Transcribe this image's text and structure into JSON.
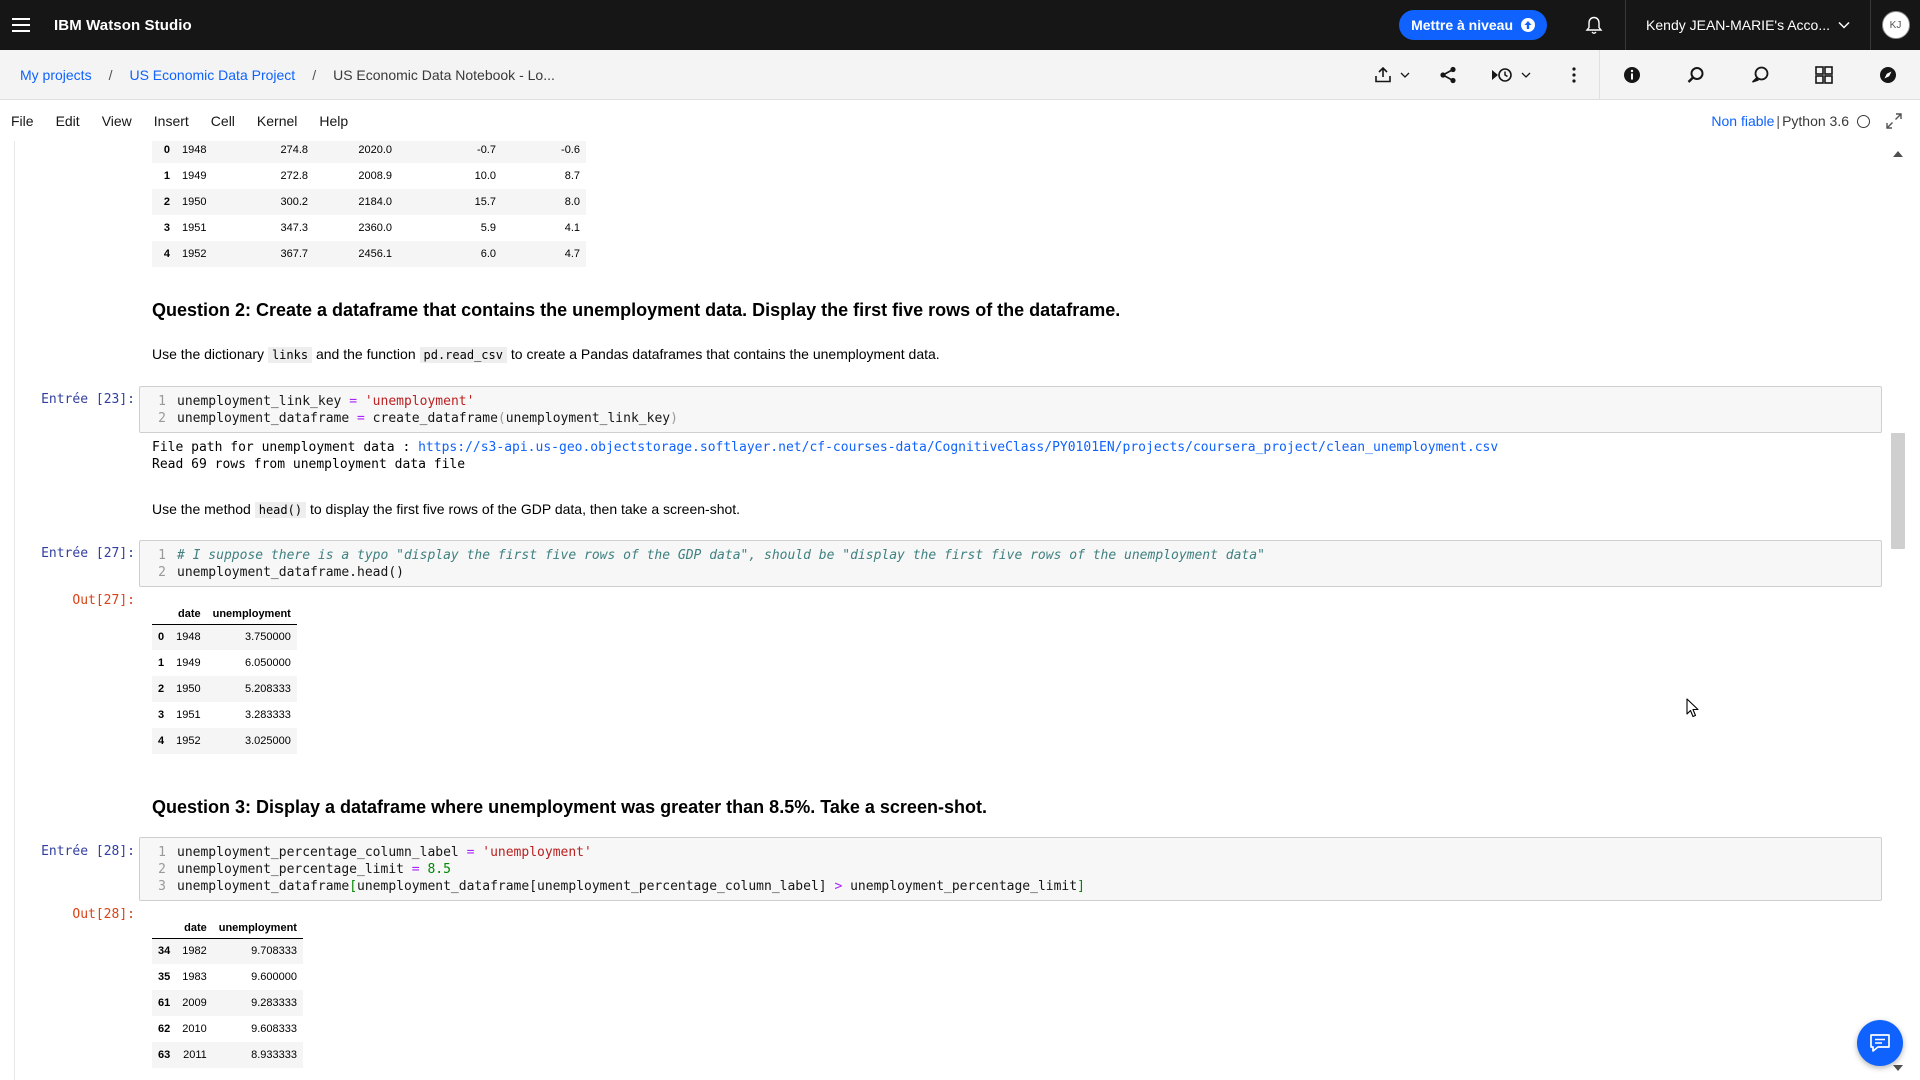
{
  "topbar": {
    "brand": "IBM Watson Studio",
    "upgrade_label": "Mettre à niveau",
    "account_label": "Kendy JEAN-MARIE's Acco...",
    "avatar_initials": "KJ"
  },
  "breadcrumb": {
    "items": [
      "My projects",
      "US Economic Data Project"
    ],
    "separator": "/",
    "current": "US Economic Data Notebook - Lo..."
  },
  "toolbar_icons": [
    "export-icon",
    "share-icon",
    "version-history-icon",
    "overflow-menu-icon",
    "info-icon",
    "find-icon",
    "comments-icon",
    "data-assets-icon",
    "explore-icon"
  ],
  "menu": {
    "items": [
      "File",
      "Edit",
      "View",
      "Insert",
      "Cell",
      "Kernel",
      "Help"
    ],
    "trust_label": "Non fiable",
    "separator": "|",
    "kernel_label": "Python 3.6"
  },
  "gdp_table_partial": {
    "rows": [
      {
        "index": "0",
        "cells": [
          "1948",
          "274.8",
          "2020.0",
          "-0.7",
          "-0.6"
        ]
      },
      {
        "index": "1",
        "cells": [
          "1949",
          "272.8",
          "2008.9",
          "10.0",
          "8.7"
        ]
      },
      {
        "index": "2",
        "cells": [
          "1950",
          "300.2",
          "2184.0",
          "15.7",
          "8.0"
        ]
      },
      {
        "index": "3",
        "cells": [
          "1951",
          "347.3",
          "2360.0",
          "5.9",
          "4.1"
        ]
      },
      {
        "index": "4",
        "cells": [
          "1952",
          "367.7",
          "2456.1",
          "6.0",
          "4.7"
        ]
      }
    ]
  },
  "question2": {
    "heading": "Question 2: Create a dataframe that contains the unemployment data. Display the first five rows of the dataframe.",
    "text_pre": "Use the dictionary ",
    "code1": "links",
    "text_mid": " and the function ",
    "code2": "pd.read_csv",
    "text_post": " to create a Pandas dataframes that contains the unemployment data."
  },
  "cell23": {
    "prompt": "Entrée [23]:",
    "line_numbers": [
      "1",
      "2"
    ],
    "line1_var": "unemployment_link_key",
    "line1_op": " = ",
    "line1_str": "'unemployment'",
    "line2_var": "unemployment_dataframe",
    "line2_op": " = ",
    "line2_fn": "create_dataframe",
    "line2_open": "(",
    "line2_arg": "unemployment_link_key",
    "line2_close": ")",
    "output_line1_pre": "File path for unemployment data : ",
    "output_line1_link": "https://s3-api.us-geo.objectstorage.softlayer.net/cf-courses-data/CognitiveClass/PY0101EN/projects/coursera_project/clean_unemployment.csv",
    "output_line2": "Read 69 rows from unemployment data file"
  },
  "md_head": {
    "text_pre": "Use the method ",
    "code": "head()",
    "text_post": " to display the first five rows of the GDP data, then take a screen-shot."
  },
  "cell27": {
    "prompt": "Entrée [27]:",
    "out_prompt": "Out[27]:",
    "line_numbers": [
      "1",
      "2"
    ],
    "line1_comment": "# I suppose there is a typo \"display the first five rows of the GDP data\", should be \"display the first five rows of the unemployment data\"",
    "line2": "unemployment_dataframe.head()",
    "table": {
      "columns": [
        "date",
        "unemployment"
      ],
      "rows": [
        {
          "index": "0",
          "cells": [
            "1948",
            "3.750000"
          ]
        },
        {
          "index": "1",
          "cells": [
            "1949",
            "6.050000"
          ]
        },
        {
          "index": "2",
          "cells": [
            "1950",
            "5.208333"
          ]
        },
        {
          "index": "3",
          "cells": [
            "1951",
            "3.283333"
          ]
        },
        {
          "index": "4",
          "cells": [
            "1952",
            "3.025000"
          ]
        }
      ]
    }
  },
  "question3": {
    "heading": "Question 3: Display a dataframe where unemployment was greater than 8.5%. Take a screen-shot."
  },
  "cell28": {
    "prompt": "Entrée [28]:",
    "out_prompt": "Out[28]:",
    "line_numbers": [
      "1",
      "2",
      "3"
    ],
    "line1_var": "unemployment_percentage_column_label",
    "line1_op": " = ",
    "line1_str": "'unemployment'",
    "line2_var": "unemployment_percentage_limit",
    "line2_op": " = ",
    "line2_num": "8.5",
    "line3_a": "unemployment_dataframe",
    "line3_open": "[",
    "line3_b": "unemployment_dataframe[unemployment_percentage_column_label] ",
    "line3_op": ">",
    "line3_c": " unemployment_percentage_limit",
    "line3_close": "]",
    "table": {
      "columns": [
        "date",
        "unemployment"
      ],
      "rows": [
        {
          "index": "34",
          "cells": [
            "1982",
            "9.708333"
          ]
        },
        {
          "index": "35",
          "cells": [
            "1983",
            "9.600000"
          ]
        },
        {
          "index": "61",
          "cells": [
            "2009",
            "9.283333"
          ]
        },
        {
          "index": "62",
          "cells": [
            "2010",
            "9.608333"
          ]
        },
        {
          "index": "63",
          "cells": [
            "2011",
            "8.933333"
          ]
        }
      ]
    }
  },
  "colors": {
    "topbar_bg": "#161616",
    "accent": "#0f62fe",
    "in_prompt": "#303f9f",
    "out_prompt": "#d84315"
  }
}
